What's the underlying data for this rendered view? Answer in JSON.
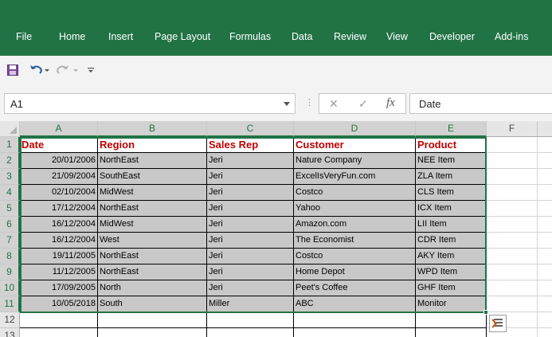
{
  "ribbon": {
    "tabs": [
      "File",
      "Home",
      "Insert",
      "Page Layout",
      "Formulas",
      "Data",
      "Review",
      "View",
      "Developer",
      "Add-ins"
    ]
  },
  "qat": {
    "icons": [
      "save-icon",
      "undo-icon",
      "redo-icon",
      "customize-qat-icon"
    ]
  },
  "formula_bar": {
    "name_box": "A1",
    "formula": "Date",
    "fx_label": "fx",
    "cancel_symbol": "✕",
    "enter_symbol": "✓",
    "separator": "⋮"
  },
  "sheet": {
    "columns": [
      "A",
      "B",
      "C",
      "D",
      "E",
      "F"
    ],
    "row_numbers": [
      "1",
      "2",
      "3",
      "4",
      "5",
      "6",
      "7",
      "8",
      "9",
      "10",
      "11",
      "12",
      "13"
    ],
    "header": [
      "Date",
      "Region",
      "Sales Rep",
      "Customer",
      "Product"
    ],
    "rows": [
      [
        "20/01/2006",
        "NorthEast",
        "Jeri",
        "Nature Company",
        "NEE Item"
      ],
      [
        "21/09/2004",
        "SouthEast",
        "Jeri",
        "ExcelIsVeryFun.com",
        "ZLA Item"
      ],
      [
        "02/10/2004",
        "MidWest",
        "Jeri",
        "Costco",
        "CLS Item"
      ],
      [
        "17/12/2004",
        "NorthEast",
        "Jeri",
        "Yahoo",
        "ICX Item"
      ],
      [
        "16/12/2004",
        "MidWest",
        "Jeri",
        "Amazon.com",
        "LII Item"
      ],
      [
        "16/12/2004",
        "West",
        "Jeri",
        "The Economist",
        "CDR Item"
      ],
      [
        "19/11/2005",
        "NorthEast",
        "Jeri",
        "Costco",
        "AKY Item"
      ],
      [
        "11/12/2005",
        "NorthEast",
        "Jeri",
        "Home Depot",
        "WPD Item"
      ],
      [
        "17/09/2005",
        "North",
        "Jeri",
        "Peet's Coffee",
        "GHF Item"
      ],
      [
        "10/05/2018",
        "South",
        "Miller",
        "ABC",
        "Monitor"
      ]
    ]
  },
  "colors": {
    "ribbon": "#217346",
    "header_text": "#c00000",
    "shaded_cell": "#c8c8c8"
  }
}
